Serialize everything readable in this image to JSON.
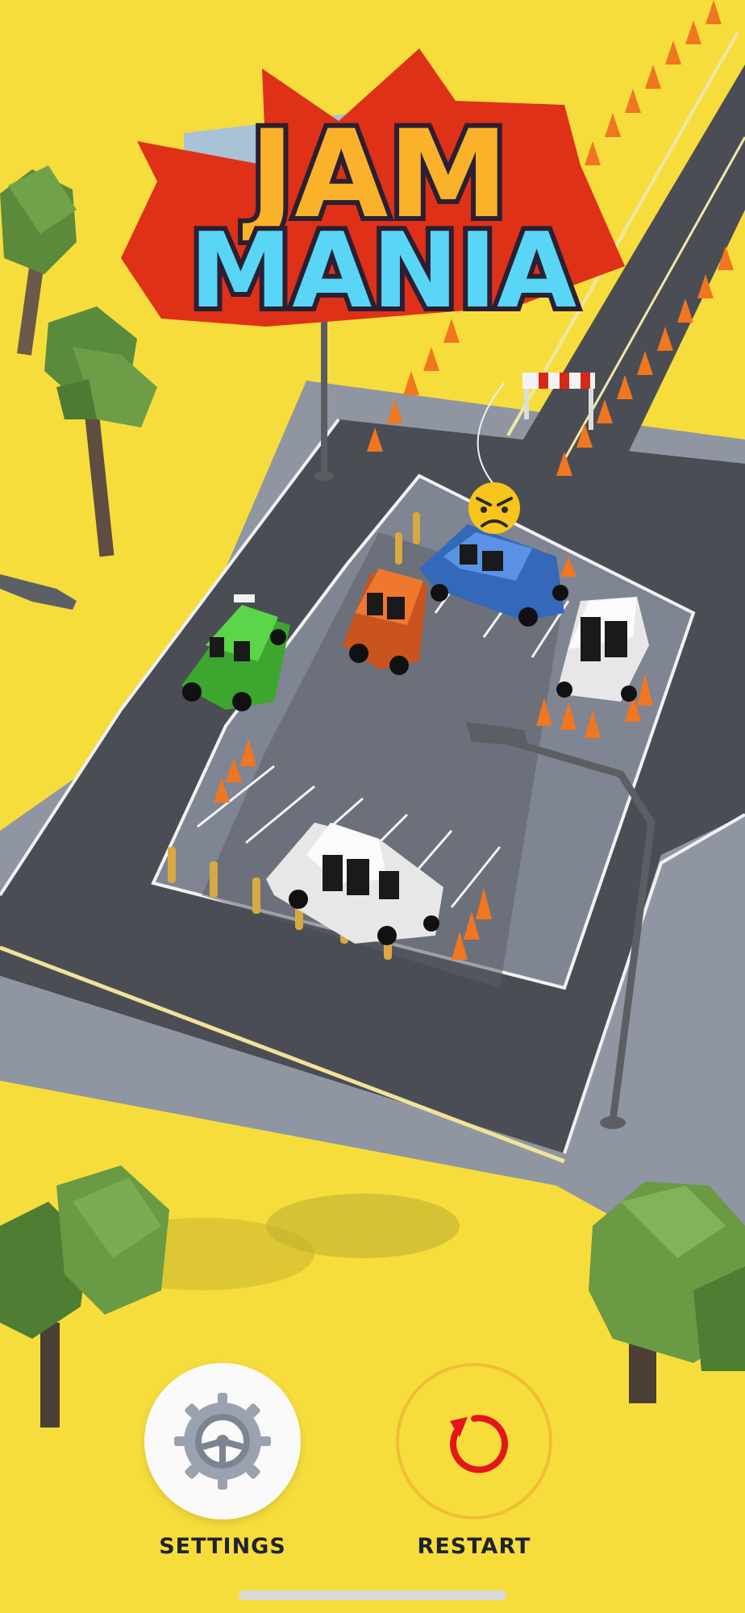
{
  "game": {
    "title_line1": "JAM",
    "title_line2": "MANIA"
  },
  "hud": {
    "settings_label": "SETTINGS",
    "restart_label": "RESTART",
    "settings_icon": "steering-wheel-gear-icon",
    "restart_icon": "restart-arrow-icon"
  },
  "scene": {
    "cars": [
      {
        "name": "green-car",
        "color": "#4cc93a"
      },
      {
        "name": "orange-car",
        "color": "#e8692a"
      },
      {
        "name": "blue-car",
        "color": "#4a82d6"
      },
      {
        "name": "white-car-right",
        "color": "#f4f4f4"
      },
      {
        "name": "white-car-bottom",
        "color": "#f4f4f4"
      }
    ],
    "angry_emoji": "angry-face-icon"
  },
  "colors": {
    "background": "#f6dd3c",
    "road": "#4a4c54",
    "lot": "#8d939e",
    "accent_red": "#d62818",
    "restart_ring": "#f1bd34"
  }
}
